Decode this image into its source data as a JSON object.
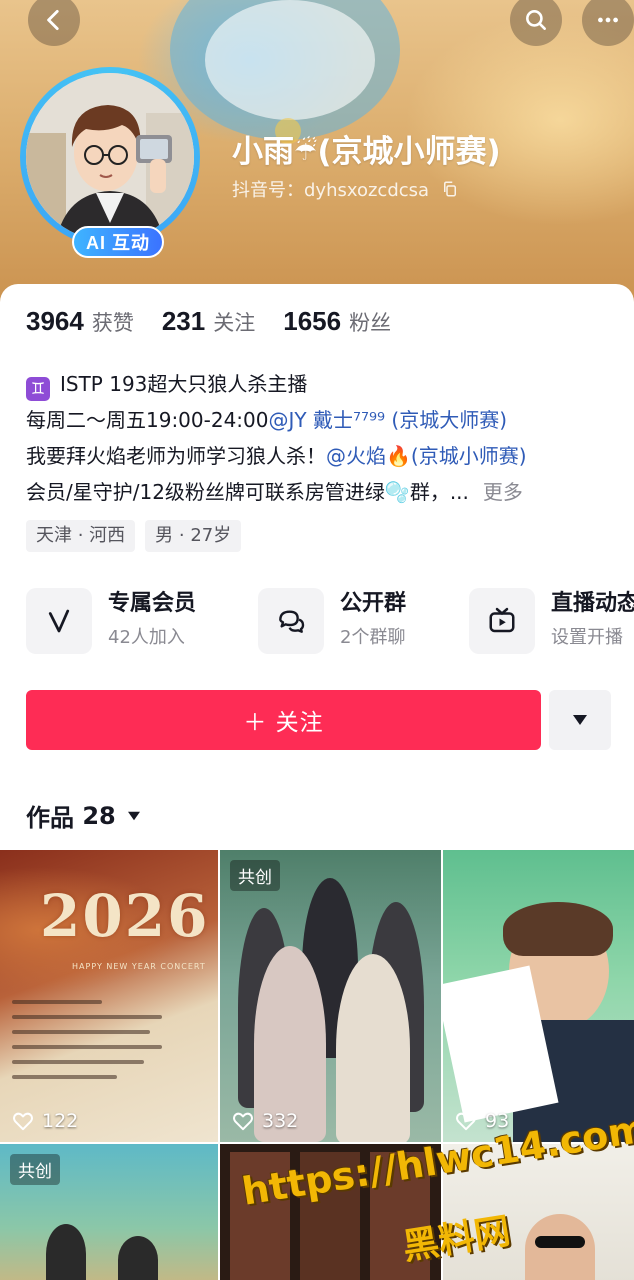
{
  "header": {
    "nickname": "小雨",
    "nickname_suffix": "(京城小师赛)",
    "douyin_id_label": "抖音号：",
    "douyin_id": "dyhsxozcdcsa",
    "ai_badge": "AI 互动"
  },
  "stats": [
    {
      "value": "3964",
      "label": "获赞"
    },
    {
      "value": "231",
      "label": "关注"
    },
    {
      "value": "1656",
      "label": "粉丝"
    }
  ],
  "bio": {
    "zodiac_icon": "♊",
    "line1": "ISTP  193超大只狼人杀主播",
    "line2_prefix": "每周二～周五19:00-24:00",
    "line2_mention": "@JY 戴士⁷⁷⁹⁹ (京城大师赛)",
    "line3_prefix": "我要拜火焰老师为师学习狼人杀！",
    "line3_mention": "@火焰🔥(京城小师赛)",
    "line4": "会员/星守护/12级粉丝牌可联系房管进绿🫧群，...",
    "more": "更多"
  },
  "tags": [
    "天津 · 河西",
    "男 · 27岁"
  ],
  "features": [
    {
      "title": "专属会员",
      "sub": "42人加入",
      "icon": "v-icon"
    },
    {
      "title": "公开群",
      "sub": "2个群聊",
      "icon": "chat-icon"
    },
    {
      "title": "直播动态",
      "sub": "设置开播",
      "icon": "tv-icon"
    }
  ],
  "follow_label": "＋ 关注",
  "works": {
    "label": "作品",
    "count": "28"
  },
  "videos": [
    {
      "likes": "122",
      "year_text": "2026",
      "concert_text": "HAPPY NEW YEAR CONCERT"
    },
    {
      "likes": "332",
      "badge": "共创"
    },
    {
      "likes": "93"
    },
    {
      "badge": "共创"
    }
  ],
  "watermark": {
    "url": "https://hlwc14.com",
    "name": "黑料网"
  },
  "colors": {
    "accent": "#fe2c55",
    "mention": "#2f5bb7",
    "ai_badge": "#3b8bff"
  }
}
